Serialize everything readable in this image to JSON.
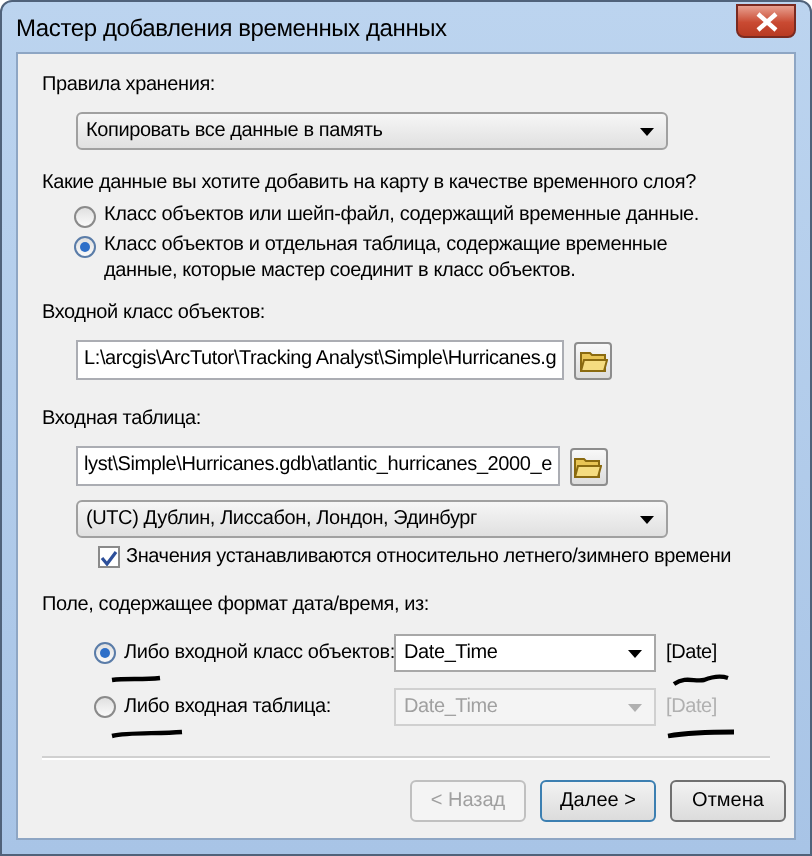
{
  "window": {
    "title": "Мастер добавления временных данных"
  },
  "storage": {
    "label": "Правила хранения:",
    "value": "Копировать все данные в память"
  },
  "data_question": {
    "label": "Какие данные вы хотите добавить на карту в качестве временного слоя?",
    "options": [
      {
        "label": "Класс объектов или шейп-файл, содержащий временные данные.",
        "selected": false
      },
      {
        "label": "Класс объектов и отдельная таблица, содержащие временные данные, которые мастер соединит в класс объектов.",
        "selected": true
      }
    ]
  },
  "input_feature_class": {
    "label": "Входной класс объектов:",
    "value": "L:\\arcgis\\ArcTutor\\Tracking Analyst\\Simple\\Hurricanes.g"
  },
  "input_table": {
    "label": "Входная таблица:",
    "value": "lyst\\Simple\\Hurricanes.gdb\\atlantic_hurricanes_2000_e"
  },
  "time_zone": {
    "value": "(UTC) Дублин, Лиссабон, Лондон, Эдинбург"
  },
  "dst": {
    "label": "Значения устанавливаются относительно летнего/зимнего времени",
    "checked": true
  },
  "date_field": {
    "label": "Поле, содержащее формат дата/время, из:",
    "options": [
      {
        "label": "Либо входной класс объектов:",
        "selected": true,
        "field": "Date_Time",
        "type": "[Date]"
      },
      {
        "label": "Либо входная таблица:",
        "selected": false,
        "field": "Date_Time",
        "type": "[Date]"
      }
    ]
  },
  "buttons": [
    {
      "label": "< Назад",
      "disabled": true,
      "default": false
    },
    {
      "label": "Далее >",
      "disabled": false,
      "default": true
    },
    {
      "label": "Отмена",
      "disabled": false,
      "default": false
    }
  ]
}
